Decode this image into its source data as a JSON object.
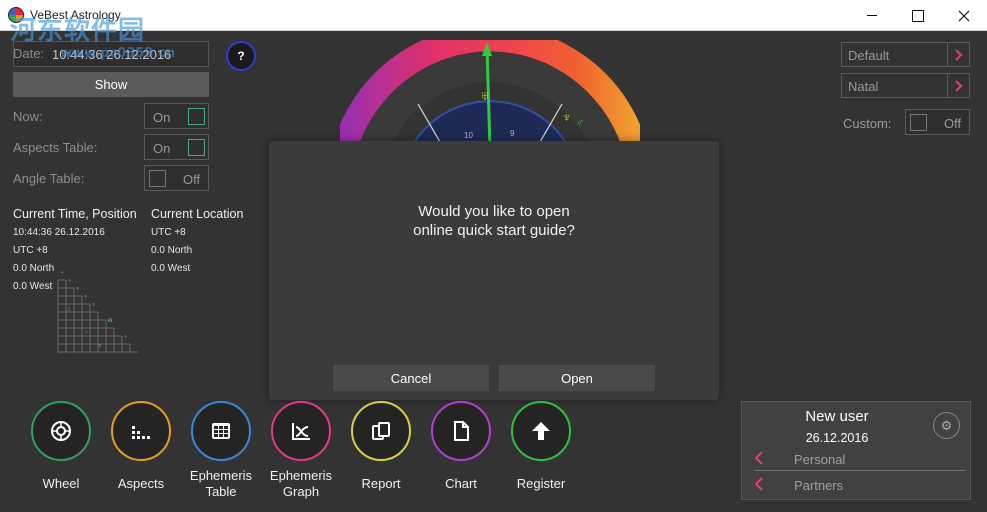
{
  "window": {
    "title": "VeBest Astrology",
    "watermark": "河东软件园",
    "watermark_url": "www.pc0359.cn"
  },
  "left": {
    "date_label": "Date:",
    "date_value": "10:44:36 26.12.2016",
    "help_label": "?",
    "show_label": "Show",
    "rows": [
      {
        "label": "Now:",
        "state": "On"
      },
      {
        "label": "Aspects Table:",
        "state": "On"
      },
      {
        "label": "Angle Table:",
        "state": "Off"
      }
    ]
  },
  "info": {
    "time_heading": "Current Time, Position",
    "time_lines": [
      "10:44:36 26.12.2016",
      "UTC +8",
      "0.0 North",
      "0.0 West"
    ],
    "location_heading": "Current Location",
    "location_lines": [
      "UTC +8",
      "0.0 North",
      "0.0 West"
    ]
  },
  "right": {
    "select1": "Default",
    "select2": "Natal",
    "custom_label": "Custom:",
    "custom_state": "Off"
  },
  "dialog": {
    "message_line1": "Would you like to open",
    "message_line2": "online quick start guide?",
    "cancel": "Cancel",
    "open": "Open"
  },
  "tools": [
    {
      "line1": "Wheel",
      "line2": "",
      "color": "#2fa060",
      "icon": "wheel-icon"
    },
    {
      "line1": "Aspects",
      "line2": "",
      "color": "#e0a020",
      "icon": "bars-icon"
    },
    {
      "line1": "Ephemeris",
      "line2": "Table",
      "color": "#3a86d8",
      "icon": "table-icon"
    },
    {
      "line1": "Ephemeris",
      "line2": "Graph",
      "color": "#e03a8a",
      "icon": "graph-icon"
    },
    {
      "line1": "Report",
      "line2": "",
      "color": "#d8d040",
      "icon": "report-icon"
    },
    {
      "line1": "Chart",
      "line2": "",
      "color": "#b040d0",
      "icon": "document-icon"
    },
    {
      "line1": "Register",
      "line2": "",
      "color": "#30c040",
      "icon": "upload-arrow-icon"
    }
  ],
  "user": {
    "name": "New user",
    "date": "26.12.2016",
    "personal": "Personal",
    "partners": "Partners"
  },
  "colors": {
    "accent_pink": "#e0407a",
    "toggle_on": "#4aa890"
  }
}
